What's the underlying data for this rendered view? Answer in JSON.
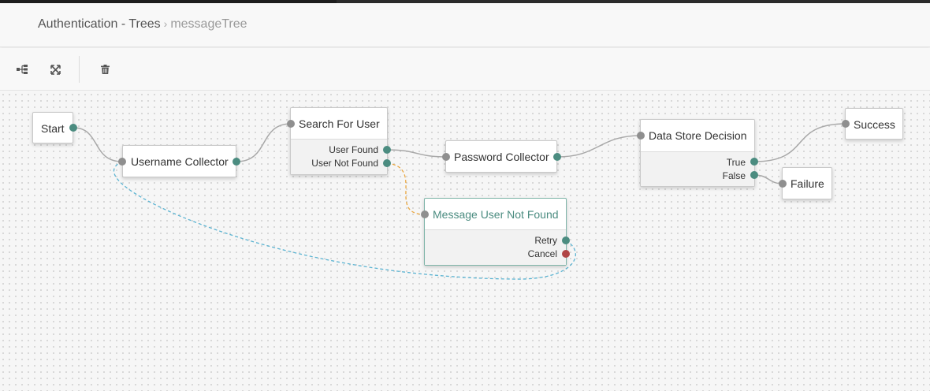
{
  "breadcrumb": {
    "parent": "Authentication - Trees",
    "separator": "›",
    "current": "messageTree"
  },
  "toolbar": {
    "layout_icon": "tree-layout-icon",
    "fit_icon": "fit-to-screen-icon",
    "delete_icon": "trash-icon"
  },
  "nodes": {
    "start": {
      "title": "Start"
    },
    "username": {
      "title": "Username Collector"
    },
    "search": {
      "title": "Search For User",
      "outcomes": [
        "User Found",
        "User Not Found"
      ]
    },
    "password": {
      "title": "Password Collector"
    },
    "message": {
      "title": "Message User Not Found",
      "outcomes": [
        "Retry",
        "Cancel"
      ]
    },
    "datastore": {
      "title": "Data Store Decision",
      "outcomes": [
        "True",
        "False"
      ]
    },
    "success": {
      "title": "Success"
    },
    "failure": {
      "title": "Failure"
    }
  },
  "colors": {
    "port_out": "#4b8c80",
    "port_in": "#8f8f8f",
    "port_cancel": "#b04545",
    "link_default": "#a8a8a8",
    "link_not_found": "#e9a741",
    "link_retry": "#5bb3d1"
  }
}
